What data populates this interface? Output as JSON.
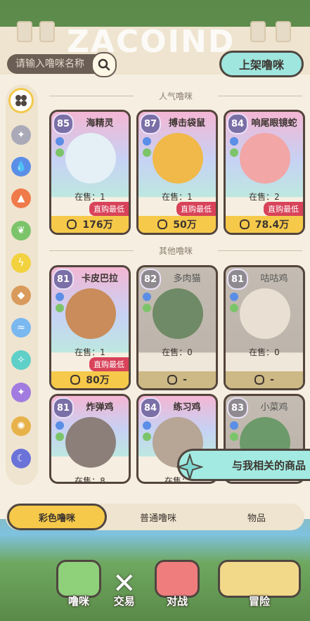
{
  "logo_text": "ZACOIND",
  "search": {
    "placeholder": "请输入噜咪名称"
  },
  "list_button": "上架噜咪",
  "sections": {
    "popular": "人气噜咪",
    "other": "其他噜咪"
  },
  "cards": [
    {
      "level": "85",
      "name": "海精灵",
      "stock": "在售：1",
      "badge": "直购最低",
      "price": "176万",
      "gray": false,
      "color": "#e4f0f6"
    },
    {
      "level": "87",
      "name": "搏击袋鼠",
      "stock": "在售：1",
      "badge": "直购最低",
      "price": "50万",
      "gray": false,
      "color": "#f0b94a"
    },
    {
      "level": "84",
      "name": "响尾眼镜蛇",
      "stock": "在售：2",
      "badge": "直购最低",
      "price": "78.4万",
      "gray": false,
      "color": "#f2a6a6"
    },
    {
      "level": "81",
      "name": "卡皮巴拉",
      "stock": "在售：1",
      "badge": "直购最低",
      "price": "80万",
      "gray": false,
      "color": "#c98c5a"
    },
    {
      "level": "82",
      "name": "多肉猫",
      "stock": "在售：0",
      "badge": "",
      "price": "-",
      "gray": true,
      "color": "#6f8a66"
    },
    {
      "level": "81",
      "name": "咕咕鸡",
      "stock": "在售：0",
      "badge": "",
      "price": "-",
      "gray": true,
      "color": "#e9e0d3"
    },
    {
      "level": "81",
      "name": "炸弹鸡",
      "stock": "在售：8",
      "badge": "",
      "price": "",
      "gray": false,
      "color": "#8c7f7a"
    },
    {
      "level": "84",
      "name": "练习鸡",
      "stock": "在售：",
      "badge": "",
      "price": "",
      "gray": false,
      "color": "#b7a596"
    },
    {
      "level": "83",
      "name": "小菜鸡",
      "stock": "",
      "badge": "",
      "price": "",
      "gray": true,
      "color": "#6d9a6a"
    }
  ],
  "related_label": "与我相关的商品",
  "categories": [
    "彩色噜咪",
    "普通噜咪",
    "物品"
  ],
  "nav": [
    "噜咪",
    "交易",
    "对战",
    "冒险"
  ],
  "colors": {
    "accent": "#f6c94a",
    "mint": "#9ee6de",
    "badge": "#d8435a"
  }
}
